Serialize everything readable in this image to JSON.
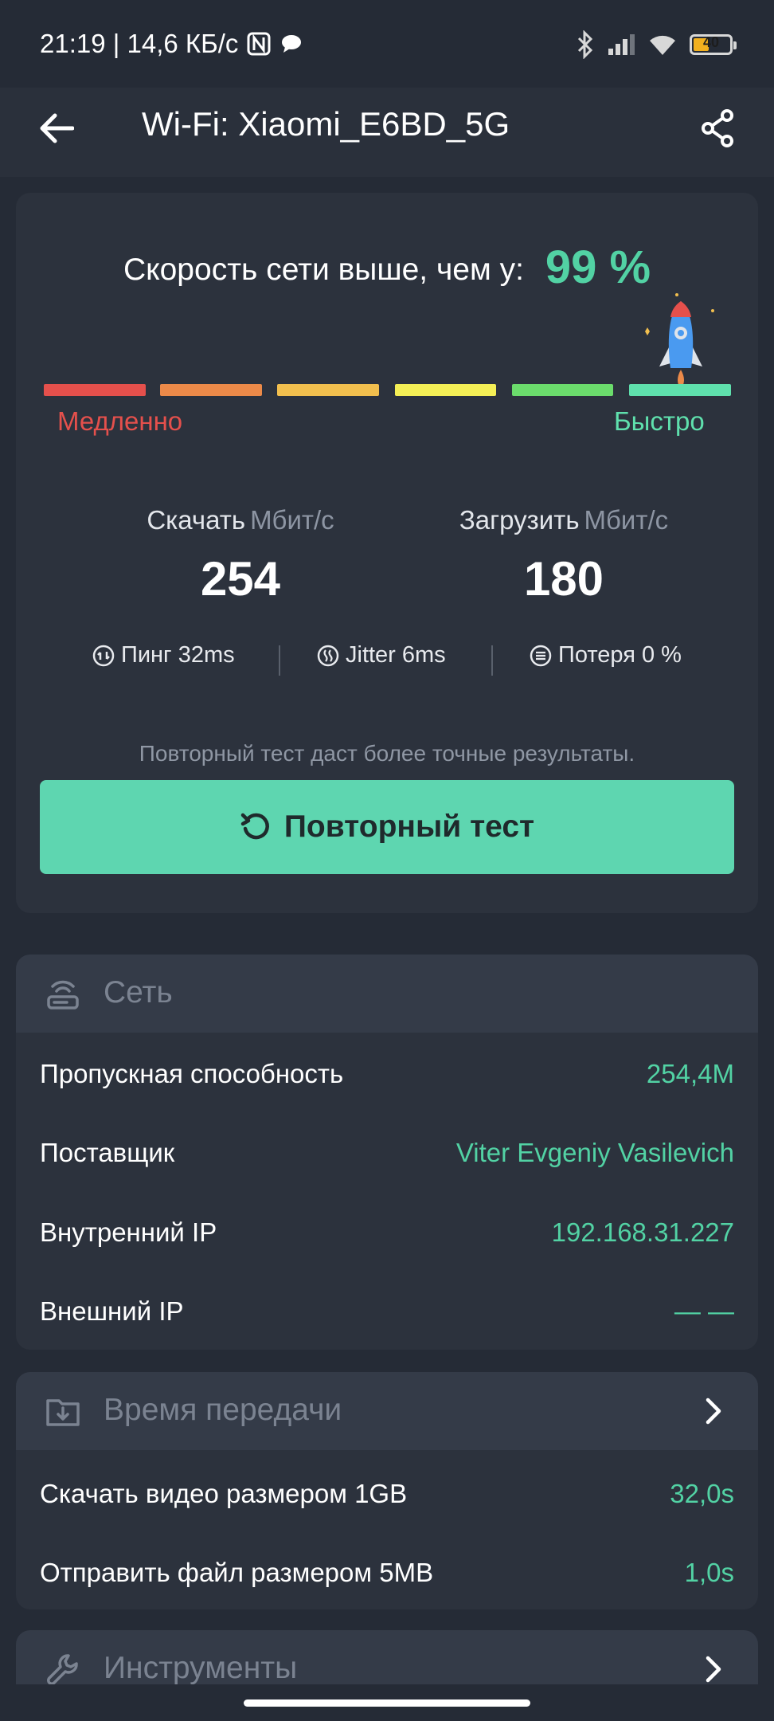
{
  "status_bar": {
    "time_speed": "21:19 | 14,6 КБ/с",
    "battery": "40"
  },
  "app_bar": {
    "title": "Wi-Fi: Xiaomi_E6BD_5G"
  },
  "result": {
    "percent_label": "Скорость сети выше, чем у:",
    "percent_value": "99 %",
    "slow_label": "Медленно",
    "fast_label": "Быстро",
    "download_label": "Скачать",
    "download_unit": "Мбит/с",
    "download_value": "254",
    "upload_label": "Загрузить",
    "upload_unit": "Мбит/с",
    "upload_value": "180",
    "ping": "Пинг 32ms",
    "jitter": "Jitter 6ms",
    "loss": "Потеря 0 %",
    "retest_hint": "Повторный тест даст более точные результаты.",
    "retest_button": "Повторный тест"
  },
  "network": {
    "title": "Сеть",
    "rows": [
      {
        "label": "Пропускная способность",
        "value": "254,4M"
      },
      {
        "label": "Поставщик",
        "value": "Viter Evgeniy Vasilevich"
      },
      {
        "label": "Внутренний IP",
        "value": "192.168.31.227"
      },
      {
        "label": "Внешний IP",
        "value": "— —"
      }
    ]
  },
  "transfer": {
    "title": "Время передачи",
    "rows": [
      {
        "label": "Скачать видео размером 1GB",
        "value": "32,0s"
      },
      {
        "label": "Отправить файл размером 5MB",
        "value": "1,0s"
      }
    ]
  },
  "tools": {
    "title": "Инструменты"
  },
  "colors": {
    "background": "#252b36",
    "card": "#2c323d",
    "accent": "#52d2a4",
    "button": "#5ed6b0",
    "slow": "#e5504c",
    "fast": "#5fe0ad"
  }
}
